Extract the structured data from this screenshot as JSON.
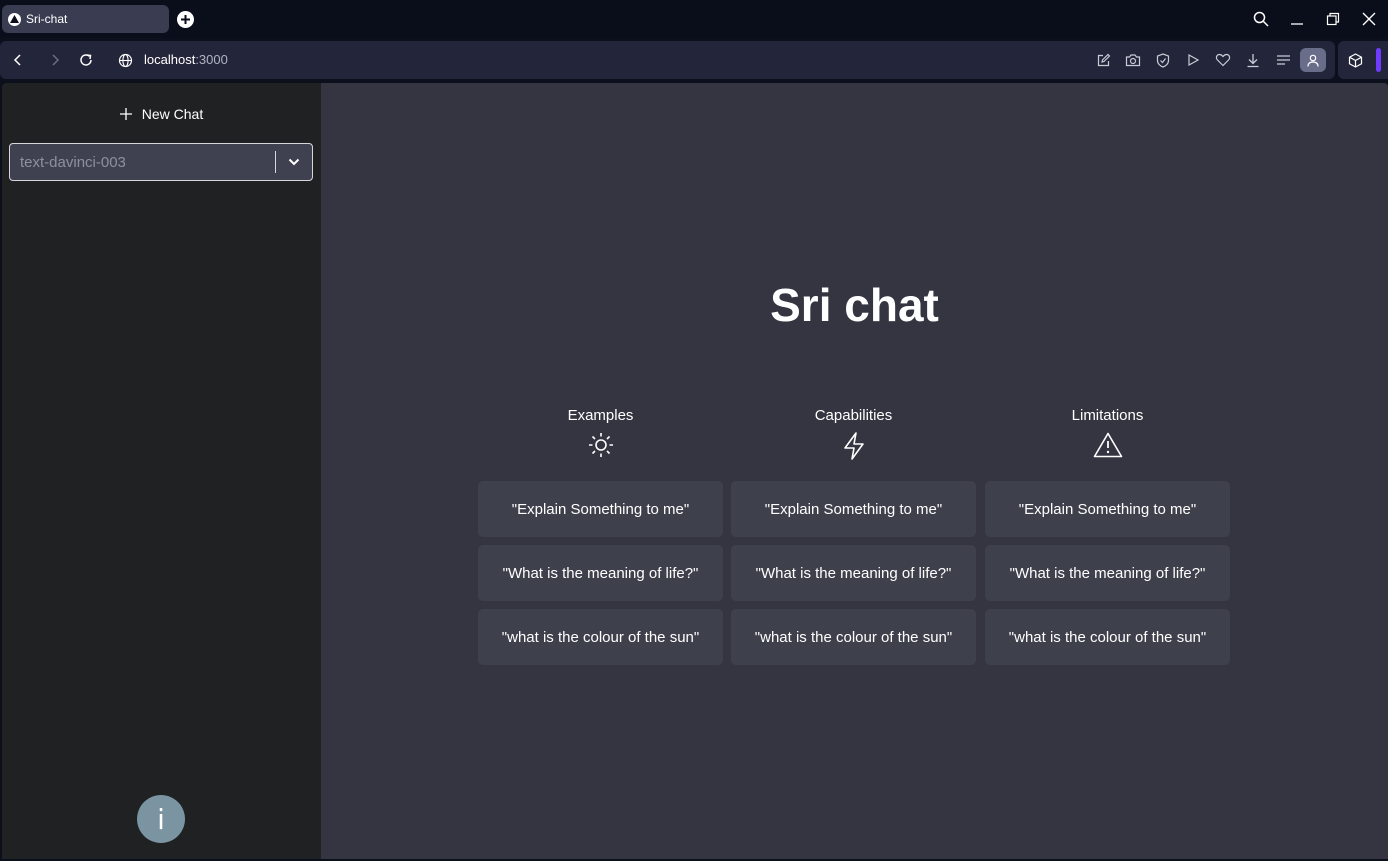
{
  "browser": {
    "tab_title": "Sri-chat",
    "url_host": "localhost",
    "url_port": ":3000"
  },
  "sidebar": {
    "new_chat_label": "New Chat",
    "model_value": "text-davinci-003",
    "info_label": "i"
  },
  "main": {
    "title": "Sri chat",
    "columns": [
      {
        "heading": "Examples",
        "icon": "sun-icon",
        "cards": [
          "\"Explain Something to me\"",
          "\"What is the meaning of life?\"",
          "\"what is the colour of the sun\""
        ]
      },
      {
        "heading": "Capabilities",
        "icon": "lightning-icon",
        "cards": [
          "\"Explain Something to me\"",
          "\"What is the meaning of life?\"",
          "\"what is the colour of the sun\""
        ]
      },
      {
        "heading": "Limitations",
        "icon": "warning-icon",
        "cards": [
          "\"Explain Something to me\"",
          "\"What is the meaning of life?\"",
          "\"what is the colour of the sun\""
        ]
      }
    ]
  },
  "colors": {
    "sidebar_bg": "#202123",
    "main_bg": "#343541",
    "card_bg": "#3e404c",
    "accent": "#6e3bff"
  }
}
